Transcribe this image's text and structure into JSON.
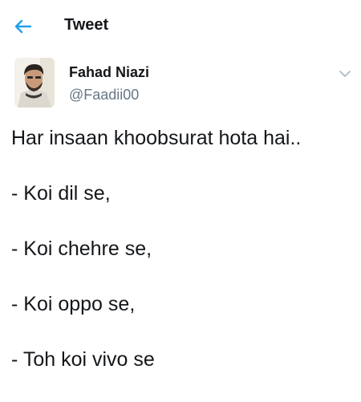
{
  "header": {
    "title": "Tweet",
    "back_icon": "arrow-left-icon",
    "accent_color": "#1da1f2"
  },
  "author": {
    "display_name": "Fahad Niazi",
    "username": "@Faadii00",
    "avatar_icon": "avatar-photo",
    "caret_icon": "chevron-down-icon"
  },
  "tweet": {
    "lines": [
      "Har insaan khoobsurat hota hai..",
      "- Koi dil se,",
      "- Koi chehre se,",
      "- Koi oppo se,",
      "- Toh koi vivo se"
    ]
  }
}
